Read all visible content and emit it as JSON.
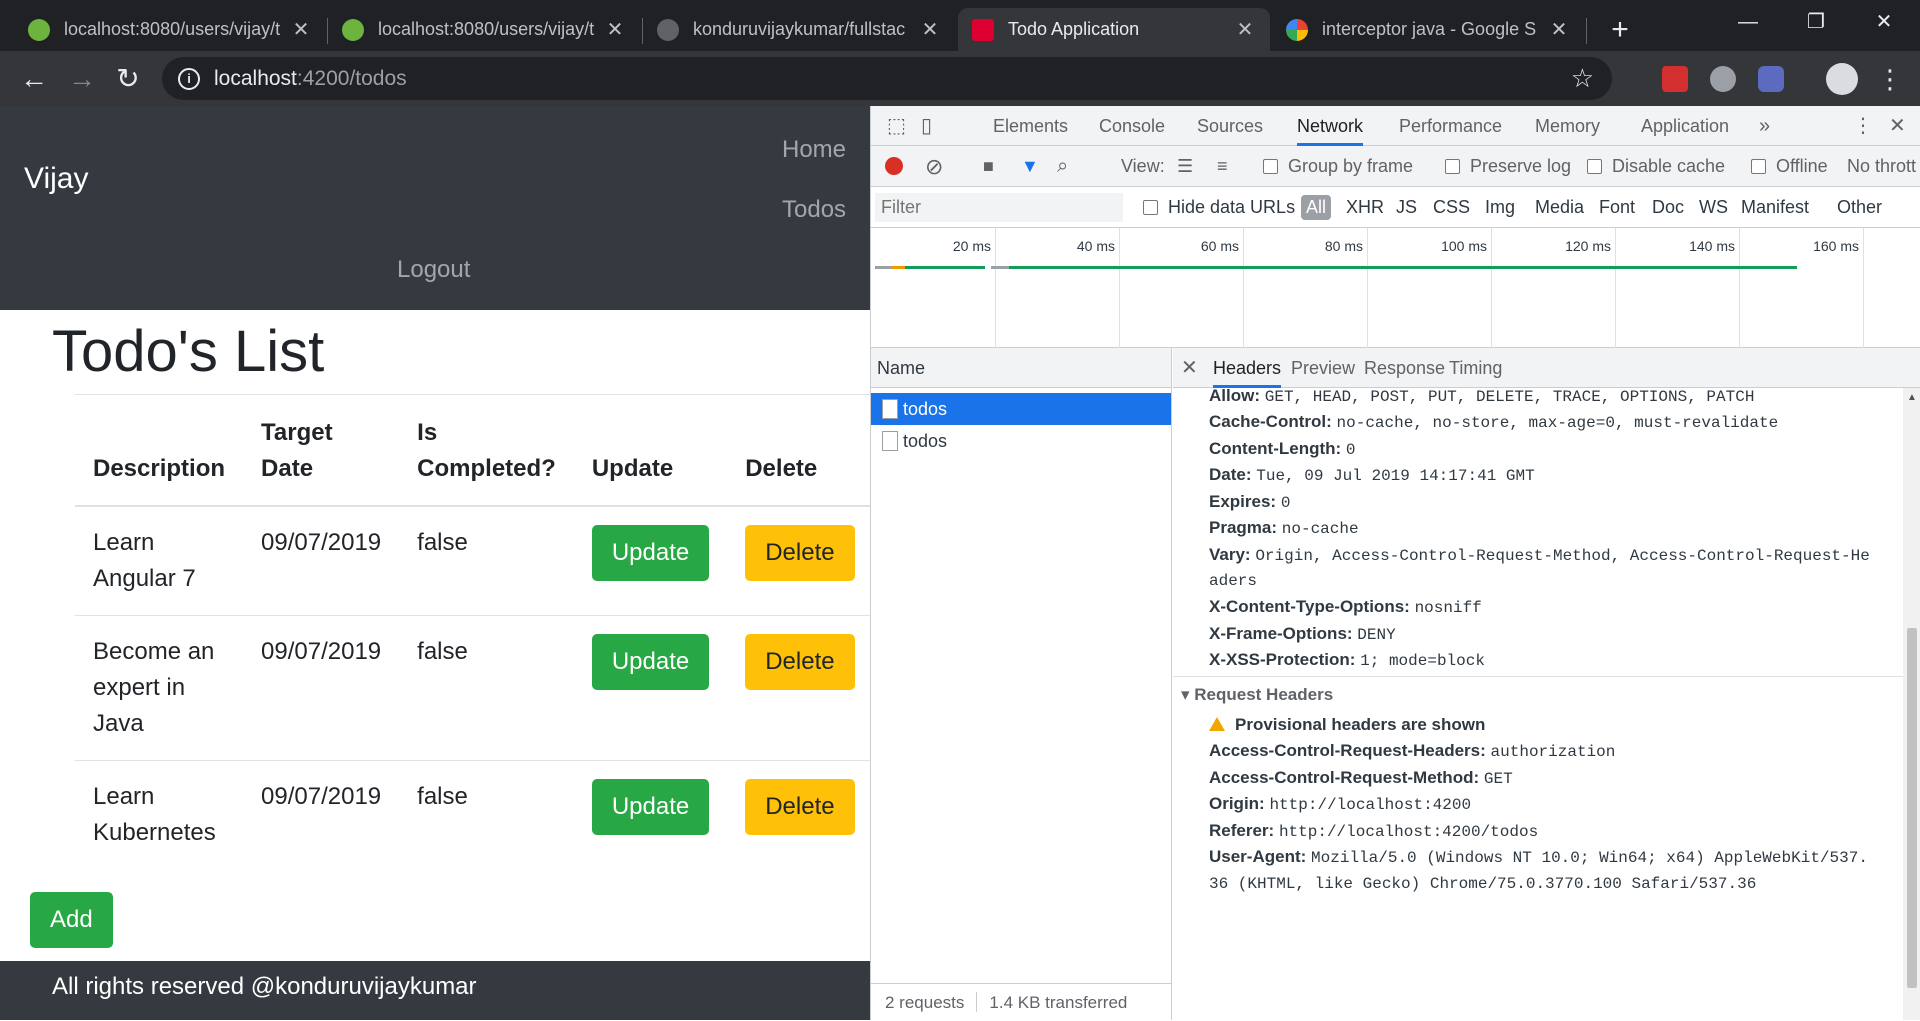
{
  "browser": {
    "tabs": [
      {
        "title": "localhost:8080/users/vijay/t",
        "favicon": "spring-leaf-icon"
      },
      {
        "title": "localhost:8080/users/vijay/t",
        "favicon": "spring-leaf-icon"
      },
      {
        "title": "konduruvijaykumar/fullstac",
        "favicon": "github-icon"
      },
      {
        "title": "Todo Application",
        "favicon": "angular-icon"
      },
      {
        "title": "interceptor java - Google S",
        "favicon": "google-icon"
      }
    ],
    "active_tab": 3,
    "url_host": "localhost",
    "url_path": ":4200/todos"
  },
  "app": {
    "brand": "Vijay",
    "nav": {
      "home": "Home",
      "todos": "Todos",
      "logout": "Logout"
    },
    "heading": "Todo's List",
    "columns": [
      "Description",
      "Target Date",
      "Is Completed?",
      "Update",
      "Delete"
    ],
    "todos": [
      {
        "description": "Learn Angular 7",
        "target_date": "09/07/2019",
        "completed": "false"
      },
      {
        "description": "Become an expert in Java",
        "target_date": "09/07/2019",
        "completed": "false"
      },
      {
        "description": "Learn Kubernetes",
        "target_date": "09/07/2019",
        "completed": "false"
      }
    ],
    "update_label": "Update",
    "delete_label": "Delete",
    "add_label": "Add",
    "footer": "All rights reserved @konduruvijaykumar"
  },
  "devtools": {
    "tabs": [
      "Elements",
      "Console",
      "Sources",
      "Network",
      "Performance",
      "Memory",
      "Application"
    ],
    "active_tab": "Network",
    "toolbar": {
      "view": "View:",
      "group_by_frame": "Group by frame",
      "preserve_log": "Preserve log",
      "disable_cache": "Disable cache",
      "offline": "Offline",
      "throttle": "No thrott"
    },
    "filter_placeholder": "Filter",
    "hide_data_urls": "Hide data URLs",
    "types": [
      "All",
      "XHR",
      "JS",
      "CSS",
      "Img",
      "Media",
      "Font",
      "Doc",
      "WS",
      "Manifest",
      "Other"
    ],
    "overview_ticks": [
      "20 ms",
      "40 ms",
      "60 ms",
      "80 ms",
      "100 ms",
      "120 ms",
      "140 ms",
      "160 ms"
    ],
    "name_header": "Name",
    "requests": [
      "todos",
      "todos"
    ],
    "status": {
      "requests": "2 requests",
      "transferred": "1.4 KB transferred"
    },
    "detail_tabs": [
      "Headers",
      "Preview",
      "Response",
      "Timing"
    ],
    "response_headers": [
      {
        "name": "Allow:",
        "value": "GET, HEAD, POST, PUT, DELETE, TRACE, OPTIONS, PATCH"
      },
      {
        "name": "Cache-Control:",
        "value": "no-cache, no-store, max-age=0, must-revalidate"
      },
      {
        "name": "Content-Length:",
        "value": "0"
      },
      {
        "name": "Date:",
        "value": "Tue, 09 Jul 2019 14:17:41 GMT"
      },
      {
        "name": "Expires:",
        "value": "0"
      },
      {
        "name": "Pragma:",
        "value": "no-cache"
      },
      {
        "name": "Vary:",
        "value": "Origin, Access-Control-Request-Method, Access-Control-Request-He"
      },
      {
        "name": "",
        "value": "aders"
      },
      {
        "name": "X-Content-Type-Options:",
        "value": "nosniff"
      },
      {
        "name": "X-Frame-Options:",
        "value": "DENY"
      },
      {
        "name": "X-XSS-Protection:",
        "value": "1; mode=block"
      }
    ],
    "request_section": "Request Headers",
    "provisional_note": "Provisional headers are shown",
    "request_headers": [
      {
        "name": "Access-Control-Request-Headers:",
        "value": "authorization"
      },
      {
        "name": "Access-Control-Request-Method:",
        "value": "GET"
      },
      {
        "name": "Origin:",
        "value": "http://localhost:4200"
      },
      {
        "name": "Referer:",
        "value": "http://localhost:4200/todos"
      },
      {
        "name": "User-Agent:",
        "value": "Mozilla/5.0 (Windows NT 10.0; Win64; x64) AppleWebKit/537."
      },
      {
        "name": "",
        "value": "36 (KHTML, like Gecko) Chrome/75.0.3770.100 Safari/537.36"
      }
    ]
  },
  "colors": {
    "accent": "#1a73e8",
    "success": "#28a745",
    "warning": "#ffc107",
    "navbar": "#343a40"
  }
}
